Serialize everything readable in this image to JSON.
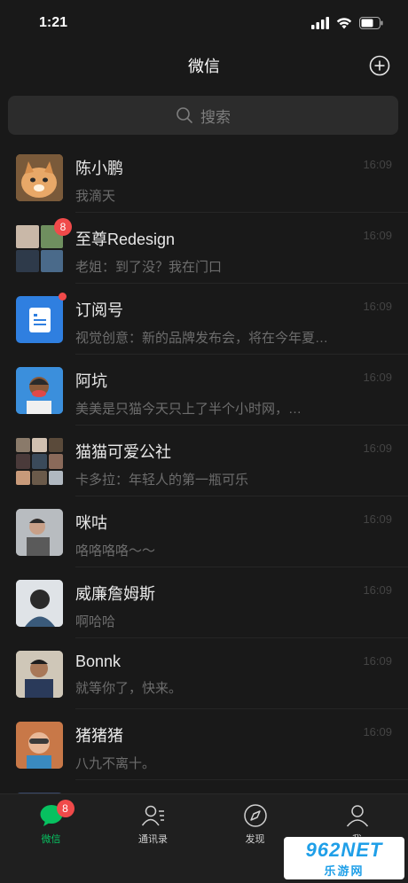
{
  "status": {
    "time": "1:21"
  },
  "header": {
    "title": "微信"
  },
  "search": {
    "placeholder": "搜索"
  },
  "chats": [
    {
      "name": "陈小鹏",
      "message": "我滴天",
      "time": "16:09"
    },
    {
      "name": "至尊Redesign",
      "message": "老姐：到了没？我在门口",
      "time": "16:09",
      "badge": "8"
    },
    {
      "name": "订阅号",
      "message": "视觉创意：新的品牌发布会，将在今年夏…",
      "time": "16:09"
    },
    {
      "name": "阿坑",
      "message": "美美是只猫今天只上了半个小时网，…",
      "time": "16:09"
    },
    {
      "name": "猫猫可爱公社",
      "message": "卡多拉：年轻人的第一瓶可乐",
      "time": "16:09"
    },
    {
      "name": "咪咕",
      "message": "咯咯咯咯～～",
      "time": "16:09"
    },
    {
      "name": "威廉詹姆斯",
      "message": "啊哈哈",
      "time": "16:09"
    },
    {
      "name": "Bonnk",
      "message": "就等你了，快来。",
      "time": "16:09"
    },
    {
      "name": "猪猪猪",
      "message": "八九不离十。",
      "time": "16:09"
    }
  ],
  "tabs": [
    {
      "label": "微信",
      "badge": "8"
    },
    {
      "label": "通讯录"
    },
    {
      "label": "发现"
    },
    {
      "label": "我"
    }
  ],
  "watermark": {
    "top": "962NET",
    "bottom": "乐游网"
  },
  "colors": {
    "accent": "#07c160",
    "badge": "#f04a4a",
    "background": "#191919"
  }
}
